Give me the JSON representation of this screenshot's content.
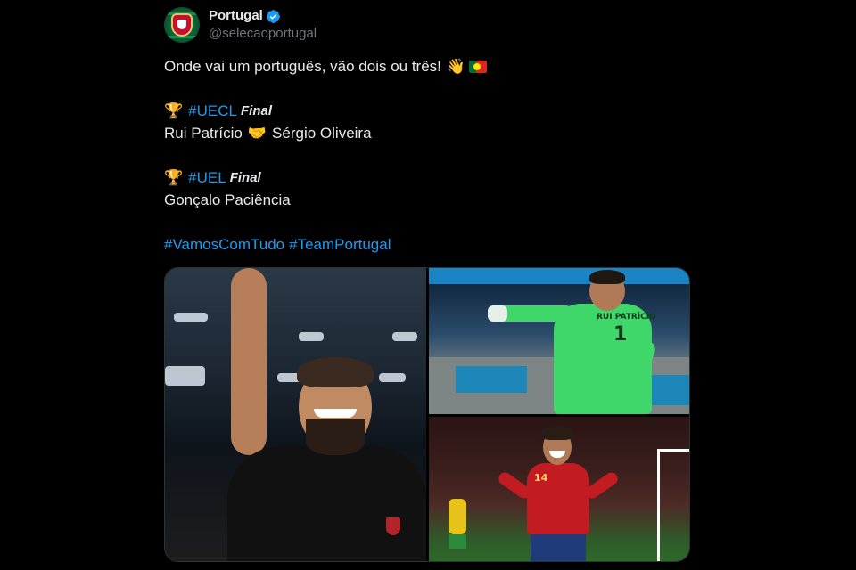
{
  "tweet": {
    "author": {
      "display_name": "Portugal",
      "handle": "@selecaoportugal",
      "verified": true,
      "avatar_icon": "fpf-crest-icon"
    },
    "lines": [
      {
        "text": "Onde vai um português, vão dois ou três!",
        "emojis": [
          "waving-hand-icon",
          "portugal-flag-icon"
        ]
      },
      {
        "lead_emoji": "🏆",
        "hashtag": "#UECL",
        "suffix": "Final"
      },
      {
        "text_a": "Rui Patrício",
        "emoji": "🤝",
        "text_b": "Sérgio Oliveira"
      },
      {
        "lead_emoji": "🏆",
        "hashtag": "#UEL",
        "suffix": "Final"
      },
      {
        "text": "Gonçalo Paciência"
      },
      {
        "hashtag_a": "#VamosComTudo",
        "hashtag_b": "#TeamPortugal"
      }
    ],
    "media": [
      {
        "name": "photo-sergio-oliveira",
        "description_icon": "player-celebration-photo"
      },
      {
        "name": "photo-rui-patricio",
        "description_icon": "goalkeeper-photo",
        "jersey_text": "RUI PATRÍCIO",
        "jersey_number": "1"
      },
      {
        "name": "photo-goncalo-paciencia",
        "description_icon": "player-celebration-photo",
        "jersey_number": "14"
      }
    ]
  },
  "colors": {
    "background": "#000000",
    "text": "#e7e9ea",
    "muted": "#71767b",
    "link": "#1d9bf0",
    "verified": "#1d9bf0"
  }
}
